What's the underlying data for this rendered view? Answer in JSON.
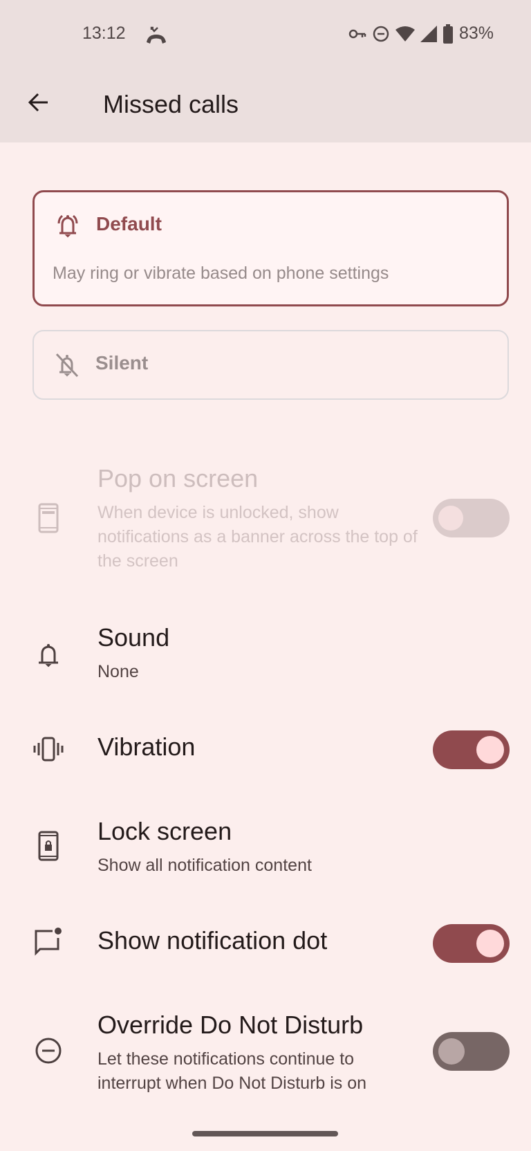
{
  "status_bar": {
    "time": "13:12",
    "notification_icon": "missed-call-icon",
    "icons": [
      "vpn-key-icon",
      "do-not-disturb-icon",
      "wifi-icon",
      "cell-signal-icon",
      "battery-icon"
    ],
    "battery_percent": "83%"
  },
  "app_bar": {
    "back_icon": "arrow-back-icon",
    "title": "Missed calls"
  },
  "behavior_options": {
    "selected": "Default",
    "default": {
      "icon": "bell-ringing-icon",
      "label": "Default",
      "description": "May ring or vibrate based on phone settings"
    },
    "silent": {
      "icon": "bell-off-icon",
      "label": "Silent"
    }
  },
  "settings": {
    "pop_on_screen": {
      "icon": "phone-banner-icon",
      "title": "Pop on screen",
      "subtitle": "When device is unlocked, show notifications as a banner across the top of the screen",
      "enabled": false,
      "checked": false
    },
    "sound": {
      "icon": "bell-icon",
      "title": "Sound",
      "subtitle": "None"
    },
    "vibration": {
      "icon": "vibration-icon",
      "title": "Vibration",
      "checked": true
    },
    "lock_screen": {
      "icon": "phone-lock-icon",
      "title": "Lock screen",
      "subtitle": "Show all notification content"
    },
    "notification_dot": {
      "icon": "notification-dot-icon",
      "title": "Show notification dot",
      "checked": true
    },
    "override_dnd": {
      "icon": "do-not-disturb-icon",
      "title": "Override Do Not Disturb",
      "subtitle": "Let these notifications continue to interrupt when Do Not Disturb is on",
      "checked": false
    }
  },
  "colors": {
    "accent": "#904a4e",
    "background": "#fceeed",
    "header_background": "#ebdfde",
    "toggle_on_thumb": "#ffd9da",
    "toggle_off_track": "#776665"
  }
}
